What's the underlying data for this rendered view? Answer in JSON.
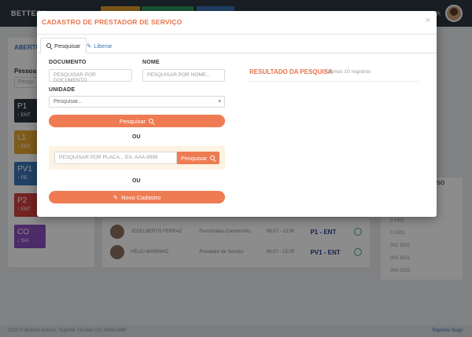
{
  "app": {
    "brand": "BETTERA",
    "user_name": "VA",
    "left_panel": {
      "title": "ABERTU MANUA",
      "label": "Pessoa",
      "input_placeholder": "Pesqu",
      "tiles": [
        {
          "code": "P1",
          "sub": "ENT",
          "color": "#2f3742"
        },
        {
          "code": "L1",
          "sub": "ENT",
          "color": "#e8a431"
        },
        {
          "code": "PV1",
          "sub": "PE",
          "color": "#3b77b8"
        },
        {
          "code": "P2",
          "sub": "ENT",
          "color": "#d2403c"
        },
        {
          "code": "CO",
          "sub": "SAI",
          "color": "#8a4fbd"
        }
      ]
    },
    "bottom_rows": [
      {
        "name": "JOSELBERTO FERRAZ",
        "role": "Funcionário Condomínio",
        "time": "06:07 - 13:30",
        "code": "P1 - ENT"
      },
      {
        "name": "HÉLIO MARINHO",
        "role": "Prestador de Serviço",
        "time": "06:07 - 15:05",
        "code": "PV1 - ENT"
      }
    ],
    "right_panel": {
      "title": "USO",
      "rows": [
        "0   1501",
        "0   1503",
        "002   1502",
        "003   1501",
        "004   2303"
      ]
    },
    "footer": {
      "left": "2015 © Bettera Acesso. Suporte Técnico (11) 4063-0480",
      "right": "Reportar Bugs"
    }
  },
  "modal": {
    "title": "CADASTRO DE PRESTADOR DE SERVIÇO",
    "close": "×",
    "tabs": [
      {
        "label": "Pesquisar",
        "active": true
      },
      {
        "label": "Liberar",
        "active": false
      }
    ],
    "documento_label": "DOCUMENTO",
    "documento_placeholder": "PESQUISAR POR DOCUMENTO",
    "nome_label": "NOME",
    "nome_placeholder": "PESQUISAR POR NOME...",
    "unidade_label": "UNIDADE",
    "unidade_value": "Pesquisar...",
    "search_button": "Pesquisar",
    "ou_1": "OU",
    "plate_placeholder": "PESQUISAR POR PLACA... EX. AAA-9999",
    "plate_button": "Pesquisar",
    "ou_2": "OU",
    "new_button": "Novo Cadastro",
    "result_title": "RESULTADO DA PESQUISA",
    "result_sub": "Últimos 10 registros"
  },
  "colors": {
    "accent": "#ef7b52",
    "title": "#e8734a",
    "link": "#3b77b8"
  }
}
